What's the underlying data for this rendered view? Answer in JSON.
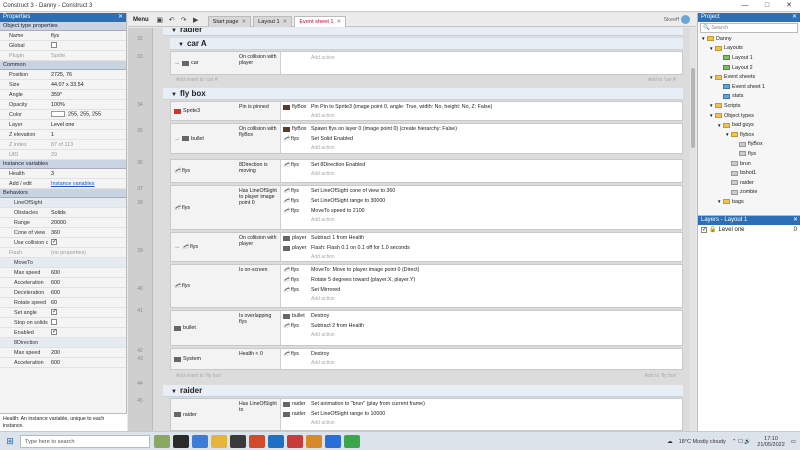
{
  "window": {
    "title": "Construct 3 - Danny - Construct 3"
  },
  "window_controls": [
    "—",
    "□",
    "✕"
  ],
  "properties": {
    "panel_title": "Properties",
    "sections": {
      "object_type": "Object type properties",
      "common": "Common",
      "instance_vars": "Instance variables",
      "behaviors": "Behaviors",
      "lineofsight": "LineOfSight",
      "moveto": "MoveTo",
      "bdirection": "8Direction"
    },
    "object": [
      {
        "k": "Name",
        "v": "flys"
      },
      {
        "k": "Global",
        "v": ""
      },
      {
        "k": "Plugin",
        "v": "Sprite"
      }
    ],
    "common": [
      {
        "k": "Position",
        "v": "2725, 76"
      },
      {
        "k": "Size",
        "v": "44.07 x 33.54"
      },
      {
        "k": "Angle",
        "v": "359°"
      },
      {
        "k": "Opacity",
        "v": "100%"
      },
      {
        "k": "Color",
        "v": "255, 255, 255"
      },
      {
        "k": "Layer",
        "v": "Level one"
      },
      {
        "k": "Z elevation",
        "v": "1"
      },
      {
        "k": "Z index",
        "v": "87 of 113"
      },
      {
        "k": "UID",
        "v": "29"
      }
    ],
    "instance_vars": [
      {
        "k": "Health",
        "v": "3"
      },
      {
        "k": "Add / edit",
        "v": "Instance variables"
      }
    ],
    "los": [
      {
        "k": "Obstacles",
        "v": "Solids"
      },
      {
        "k": "Range",
        "v": "20000"
      },
      {
        "k": "Cone of view",
        "v": "360"
      },
      {
        "k": "Use collision cells",
        "v": ""
      }
    ],
    "flash": {
      "k": "Flash",
      "v": "(no properties)"
    },
    "moveto": [
      {
        "k": "Max speed",
        "v": "600"
      },
      {
        "k": "Acceleration",
        "v": "600"
      },
      {
        "k": "Deceleration",
        "v": "600"
      },
      {
        "k": "Rotate speed",
        "v": "60"
      },
      {
        "k": "Set angle",
        "v": ""
      },
      {
        "k": "Stop on solids",
        "v": ""
      },
      {
        "k": "Enabled",
        "v": ""
      }
    ],
    "bdir": [
      {
        "k": "Max speed",
        "v": "200"
      },
      {
        "k": "Acceleration",
        "v": "600"
      }
    ],
    "help": "Health: An instance variable, unique to each instance."
  },
  "toolbar": {
    "menu": "Menu",
    "tabs": [
      "Start page",
      "Layout 1",
      "Event sheet 1"
    ],
    "user": "Skeeff",
    "icons": [
      "save-icon",
      "undo-icon",
      "redo-icon",
      "play-icon"
    ],
    "glyphs": {
      "save": "▣",
      "undo": "↶",
      "redo": "↷",
      "play": "▶"
    }
  },
  "sheet": {
    "line_numbers": [
      "32",
      "33",
      "34",
      "35",
      "36",
      "37",
      "38",
      "39",
      "40",
      "41",
      "42",
      "43",
      "44",
      "45"
    ],
    "groups": {
      "radier_top": "radier",
      "car_a": "car A",
      "fly_box": "fly box",
      "raider": "raider"
    },
    "car_event": {
      "obj": "car",
      "cond": "On collision with player",
      "add_action": "Add action",
      "add_event": "Add event to 'car A'",
      "add_event_right": "Add to 'car A'"
    },
    "e1": {
      "obj": "Sprite3",
      "cond": "Pin is pinned",
      "acts": [
        {
          "o": "flyBox",
          "t": "Pin Pin to Sprite3 (image point 0, angle: True, width: No, height: No, Z: False)"
        }
      ]
    },
    "e2": {
      "obj": "bullet",
      "cond": "On collision with flyBox",
      "acts": [
        {
          "o": "flyBox",
          "t": "Spawn flys on layer 0 (image point 0) (create hierarchy: False)"
        },
        {
          "o": "flys",
          "t": "Set Solid Enabled"
        }
      ]
    },
    "e3": {
      "obj": "flys",
      "cond": "8Direction is moving",
      "acts": [
        {
          "o": "flys",
          "t": "Set 8Direction Enabled"
        }
      ]
    },
    "e4": {
      "obj": "flys",
      "cond": "Has LineOfSight to player image point 0",
      "acts": [
        {
          "o": "flys",
          "t": "Set LineOfSight cone of view to 360"
        },
        {
          "o": "flys",
          "t": "Set LineOfSight range to 30000"
        },
        {
          "o": "flys",
          "t": "MoveTo speed to 2100"
        }
      ]
    },
    "e5": {
      "obj": "flys",
      "cond": "On collision with player",
      "acts": [
        {
          "o": "player",
          "t": "Subtract 1 from Health"
        },
        {
          "o": "player",
          "t": "Flash: Flash 0.1 on 0.1 off for 1.0 seconds"
        }
      ]
    },
    "e6": {
      "obj": "flys",
      "cond": "Is on-screen",
      "acts": [
        {
          "o": "flys",
          "t": "MoveTo: Move to player image point 0 (Direct)"
        },
        {
          "o": "flys",
          "t": "Rotate 5 degrees toward (player.X, player.Y)"
        },
        {
          "o": "flys",
          "t": "Set Mirrored"
        }
      ]
    },
    "e7": {
      "obj": "bullet",
      "cond": "Is overlapping flys",
      "acts": [
        {
          "o": "bullet",
          "t": "Destroy"
        },
        {
          "o": "flys",
          "t": "Subtract 2 from Health"
        }
      ]
    },
    "e8": {
      "obj": "System",
      "cond": "Health < 0",
      "acts": [
        {
          "o": "flys",
          "t": "Destroy"
        }
      ]
    },
    "add_event_fly": "Add event to 'fly box'",
    "add_event_fly_right": "Add to 'fly box'",
    "e9": {
      "obj": "raider",
      "cond": "Has LineOfSight to",
      "acts": [
        {
          "o": "raider",
          "t": "Set animation to \"brun\" (play from current frame)"
        },
        {
          "o": "raider",
          "t": "Set LineOfSight range to 10000"
        }
      ]
    },
    "add_action": "Add action"
  },
  "project": {
    "title": "Project",
    "search": "Search",
    "items": [
      {
        "label": "Danny",
        "depth": 0,
        "icon": "folder"
      },
      {
        "label": "Layouts",
        "depth": 1,
        "icon": "folder"
      },
      {
        "label": "Layout 1",
        "depth": 2,
        "icon": "lay"
      },
      {
        "label": "Layout 2",
        "depth": 2,
        "icon": "lay"
      },
      {
        "label": "Event sheets",
        "depth": 1,
        "icon": "folder"
      },
      {
        "label": "Event sheet 1",
        "depth": 2,
        "icon": "sheeti"
      },
      {
        "label": "stats",
        "depth": 2,
        "icon": "sheeti"
      },
      {
        "label": "Scripts",
        "depth": 1,
        "icon": "folder"
      },
      {
        "label": "Object types",
        "depth": 1,
        "icon": "folder"
      },
      {
        "label": "bad guys",
        "depth": 2,
        "icon": "folder"
      },
      {
        "label": "flybox",
        "depth": 3,
        "icon": "folder"
      },
      {
        "label": "flyBox",
        "depth": 4,
        "icon": "plain"
      },
      {
        "label": "flys",
        "depth": 4,
        "icon": "plain"
      },
      {
        "label": "brun",
        "depth": 3,
        "icon": "plain"
      },
      {
        "label": "bshot1",
        "depth": 3,
        "icon": "plain"
      },
      {
        "label": "raider",
        "depth": 3,
        "icon": "plain"
      },
      {
        "label": "zombie",
        "depth": 3,
        "icon": "plain"
      },
      {
        "label": "bags",
        "depth": 2,
        "icon": "folder"
      }
    ]
  },
  "layers": {
    "title": "Layers - Layout 1",
    "items": [
      {
        "label": "Level one",
        "value": "0"
      }
    ]
  },
  "taskbar": {
    "search": "Type here to search",
    "weather": "18°C  Mostly cloudy",
    "time": "17:10",
    "date": "21/05/2022"
  }
}
